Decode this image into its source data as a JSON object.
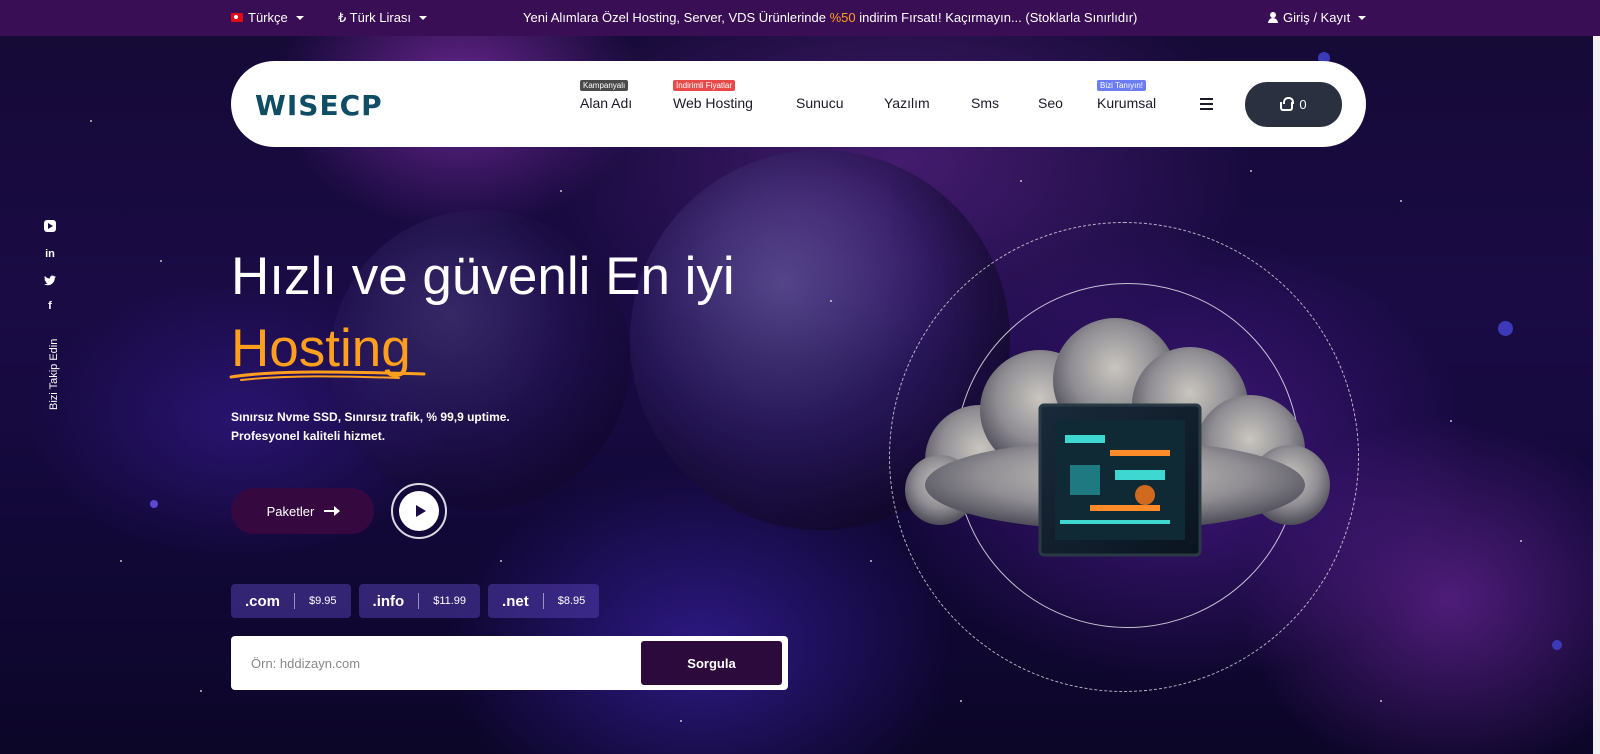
{
  "topbar": {
    "language": "Türkçe",
    "currency": "₺ Türk Lirası",
    "announcement_pre": "Yeni Alımlara Özel Hosting, Server, VDS Ürünlerinde ",
    "announcement_highlight": "%50",
    "announcement_post": " indirim Fırsatı! Kaçırmayın... (Stoklarla Sınırlıdır)",
    "login": "Giriş / Kayıt"
  },
  "nav": {
    "logo": "WISECP",
    "items": [
      {
        "label": "Alan Adı",
        "badge": "Kampanyalı",
        "badge_color": "#4a4a4a"
      },
      {
        "label": "Web Hosting",
        "badge": "İndirimli Fiyatlar",
        "badge_color": "#e84a4a"
      },
      {
        "label": "Sunucu",
        "badge": "",
        "badge_color": ""
      },
      {
        "label": "Yazılım",
        "badge": "",
        "badge_color": ""
      },
      {
        "label": "Sms",
        "badge": "",
        "badge_color": ""
      },
      {
        "label": "Seo",
        "badge": "",
        "badge_color": ""
      },
      {
        "label": "Kurumsal",
        "badge": "Bizi Tanıyın!",
        "badge_color": "#6b7cf5"
      }
    ],
    "cart_count": "0"
  },
  "social": {
    "follow_label": "Bizi Takip Edin",
    "icons": [
      "youtube-icon",
      "linkedin-icon",
      "twitter-icon",
      "facebook-icon"
    ]
  },
  "hero": {
    "title": "Hızlı ve güvenli En iyi",
    "accent": "Hosting",
    "accent_color": "#ff9f1c",
    "desc_line1": "Sınırsız Nvme SSD, Sınırsız trafik, % 99,9 uptime.",
    "desc_line2": "Profesyonel kaliteli hizmet.",
    "packages_label": "Paketler"
  },
  "domains": [
    {
      "tld": ".com",
      "price": "$9.95"
    },
    {
      "tld": ".info",
      "price": "$11.99"
    },
    {
      "tld": ".net",
      "price": "$8.95"
    }
  ],
  "search": {
    "placeholder": "Örn: hddizayn.com",
    "button_label": "Sorgula"
  }
}
